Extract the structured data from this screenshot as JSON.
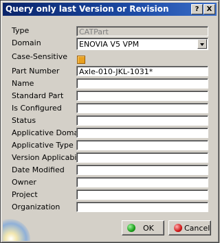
{
  "window": {
    "title": "Query only last Version or Revision"
  },
  "titlebar": {
    "help_button": "?",
    "close_button": "X"
  },
  "form": {
    "type": {
      "label": "Type",
      "value": "CATPart"
    },
    "domain": {
      "label": "Domain",
      "value": "ENOVIA V5 VPM"
    },
    "case_sensitive": {
      "label": "Case-Sensitive",
      "checked": true
    },
    "part_number": {
      "label": "Part Number",
      "value": "Axle-010-JKL-1031*"
    },
    "name": {
      "label": "Name",
      "value": ""
    },
    "standard_part": {
      "label": "Standard Part",
      "value": ""
    },
    "is_configured": {
      "label": "Is Configured",
      "value": ""
    },
    "status": {
      "label": "Status",
      "value": ""
    },
    "applicative_domain": {
      "label": "Applicative Domain",
      "value": ""
    },
    "applicative_type": {
      "label": "Applicative Type",
      "value": ""
    },
    "version_applicability": {
      "label": "Version Applicability",
      "value": ""
    },
    "date_modified": {
      "label": "Date Modified",
      "value": ""
    },
    "owner": {
      "label": "Owner",
      "value": ""
    },
    "project": {
      "label": "Project",
      "value": ""
    },
    "organization": {
      "label": "Organization",
      "value": ""
    }
  },
  "buttons": {
    "ok": "OK",
    "cancel": "Cancel"
  },
  "colors": {
    "titlebar": "#0a246a",
    "ok_icon": "#1aa01a",
    "cancel_icon": "#d01818",
    "checkbox": "#e8a020"
  }
}
